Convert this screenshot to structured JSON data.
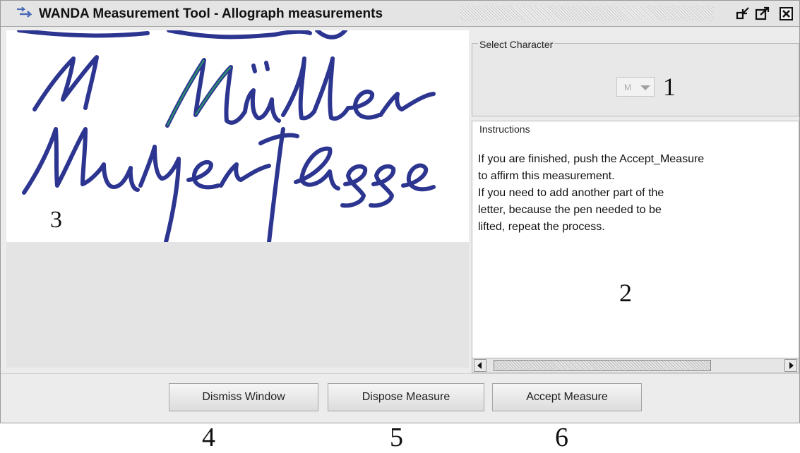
{
  "window": {
    "title": "WANDA Measurement Tool - Allograph measurements"
  },
  "select_character": {
    "legend": "Select Character",
    "selected": "M"
  },
  "instructions": {
    "legend": "Instructions",
    "lines": [
      "If you are finished, push the Accept_Measure",
      "to affirm this measurement.",
      "If you need to add another part of the",
      "letter, because the pen needed to be",
      "lifted, repeat the process."
    ]
  },
  "buttons": {
    "dismiss": "Dismiss Window",
    "dispose": "Dispose Measure",
    "accept": "Accept Measure"
  },
  "callouts": {
    "n1": "1",
    "n2": "2",
    "n3": "3",
    "n4": "4",
    "n5": "5",
    "n6": "6"
  },
  "colors": {
    "ink": "#2c3590",
    "highlight": "#2a9a6a"
  }
}
